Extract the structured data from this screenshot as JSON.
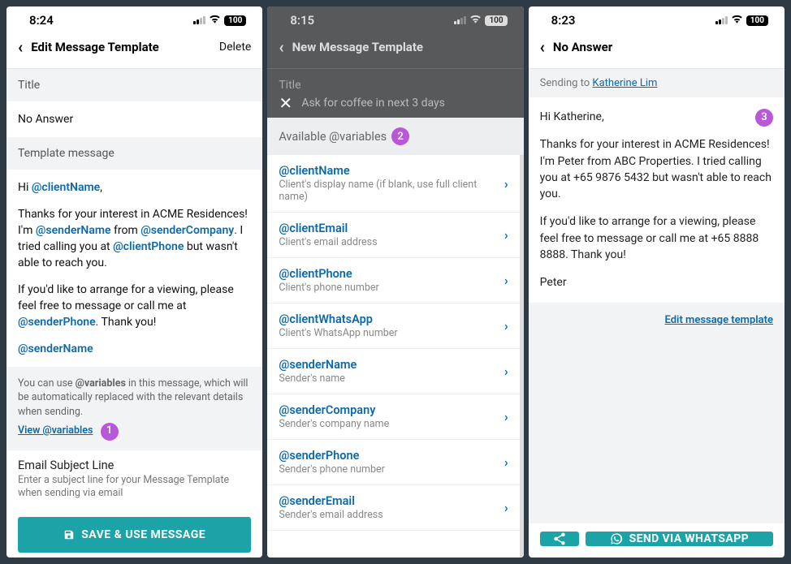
{
  "phone1": {
    "time": "8:24",
    "battery": "100",
    "header_title": "Edit Message Template",
    "header_action": "Delete",
    "title_label": "Title",
    "title_value": "No Answer",
    "template_label": "Template message",
    "msg_line1_pre": "Hi ",
    "msg_line1_var": "@clientName",
    "msg_line1_post": ",",
    "msg_p2_a": "Thanks for your interest in ACME Residences! I'm ",
    "msg_p2_v1": "@senderName",
    "msg_p2_b": " from ",
    "msg_p2_v2": "@senderCompany",
    "msg_p2_c": ". I tried calling you at ",
    "msg_p2_v3": "@clientPhone",
    "msg_p2_d": " but wasn't able to reach you.",
    "msg_p3_a": "If you'd like to arrange for a viewing, please feel free to message or call me at ",
    "msg_p3_v1": "@senderPhone",
    "msg_p3_b": ". Thank you!",
    "msg_sig": "@senderName",
    "hint_a": "You can use ",
    "hint_b": "@variables",
    "hint_c": " in this message, which will be automatically replaced with the relevant details when sending.",
    "hint_link": "View @variables",
    "badge1": "1",
    "subject_title": "Email Subject Line",
    "subject_desc": "Enter a subject line for your Message Template when sending via email",
    "save_btn": "SAVE & USE MESSAGE"
  },
  "phone2": {
    "time": "8:15",
    "battery": "100",
    "header_title": "New Message Template",
    "title_label": "Title",
    "placeholder": "Ask for coffee in next 3 days",
    "sheet_title": "Available @variables",
    "badge2": "2",
    "vars": [
      {
        "name": "@clientName",
        "desc": "Client's display name (if blank, use full client name)"
      },
      {
        "name": "@clientEmail",
        "desc": "Client's email address"
      },
      {
        "name": "@clientPhone",
        "desc": "Client's phone number"
      },
      {
        "name": "@clientWhatsApp",
        "desc": "Client's WhatsApp number"
      },
      {
        "name": "@senderName",
        "desc": "Sender's name"
      },
      {
        "name": "@senderCompany",
        "desc": "Sender's company name"
      },
      {
        "name": "@senderPhone",
        "desc": "Sender's phone number"
      },
      {
        "name": "@senderEmail",
        "desc": "Sender's email address"
      }
    ]
  },
  "phone3": {
    "time": "8:23",
    "battery": "100",
    "header_title": "No Answer",
    "sending_label": "Sending to ",
    "recipient": "Katherine Lim",
    "badge3": "3",
    "p1": "Hi Katherine,",
    "p2": "Thanks for your interest in ACME Residences! I'm Peter from ABC Properties. I tried calling you at +65 9876 5432 but wasn't able to reach you.",
    "p3": "If you'd like to arrange for a viewing, please feel free to message or call me at +65 8888 8888. Thank you!",
    "p4": "Peter",
    "edit_link": "Edit message template",
    "send_btn": "SEND VIA WHATSAPP"
  }
}
